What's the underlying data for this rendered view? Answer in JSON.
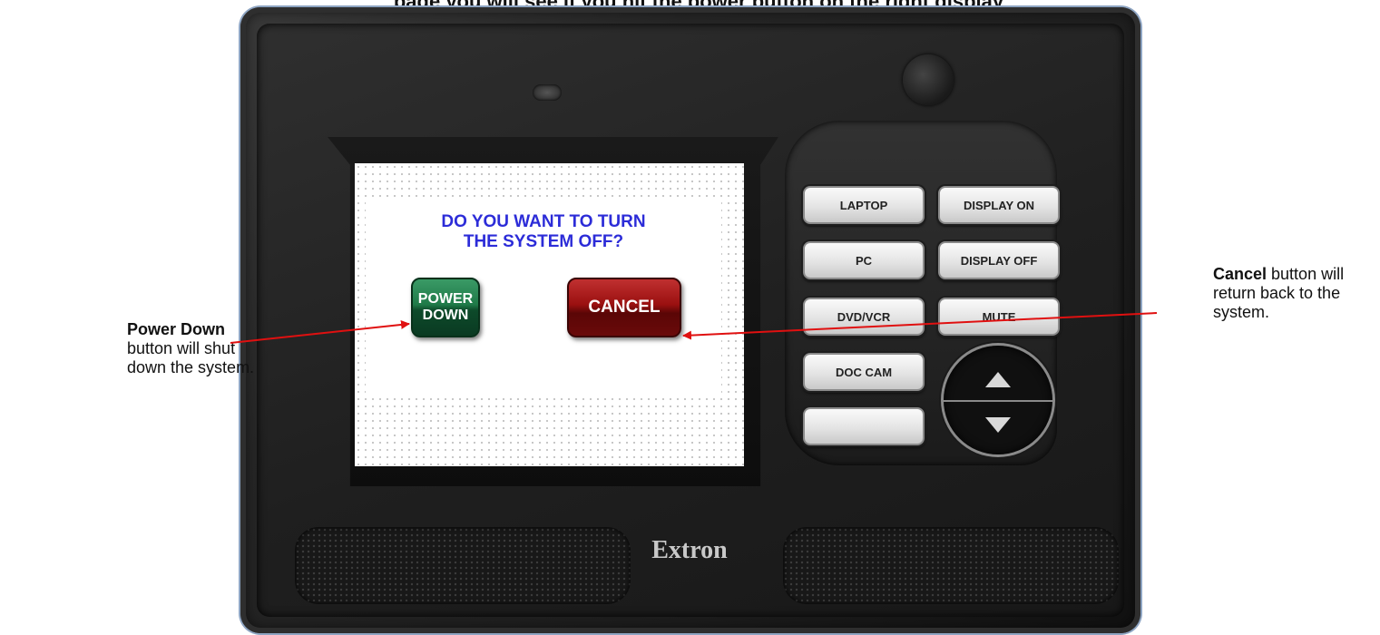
{
  "caption_top": "page you will see if you hit the power button on the right display",
  "device": {
    "logo": "Extron"
  },
  "screen": {
    "question_line1": "DO YOU WANT TO TURN",
    "question_line2": "THE SYSTEM OFF?",
    "power_down_line1": "POWER",
    "power_down_line2": "DOWN",
    "cancel_label": "CANCEL"
  },
  "keypad": {
    "buttons": [
      {
        "label": "LAPTOP"
      },
      {
        "label": "DISPLAY ON"
      },
      {
        "label": "PC"
      },
      {
        "label": "DISPLAY OFF"
      },
      {
        "label": "DVD/VCR"
      },
      {
        "label": "MUTE"
      },
      {
        "label": "DOC CAM"
      },
      {
        "label": ""
      }
    ],
    "nav": [
      "up-arrow-icon",
      "down-arrow-icon"
    ]
  },
  "annotations": {
    "left_bold": "Power Down",
    "left_rest": " button will shut down the system.",
    "right_bold": "Cancel",
    "right_rest": " button will return back to the system."
  },
  "colors": {
    "arrow": "#e01010",
    "question_text": "#2c2cd8",
    "power_down": "#1f7a48",
    "cancel": "#9a1010"
  }
}
